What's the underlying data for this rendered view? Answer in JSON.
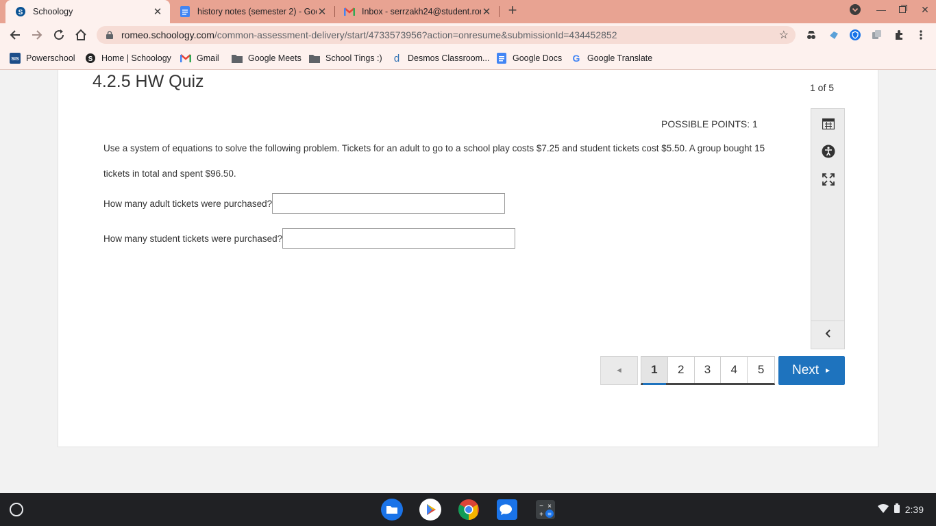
{
  "browser": {
    "tabs": [
      {
        "title": "Schoology",
        "icon": "schoology-icon",
        "active": true
      },
      {
        "title": "history notes (semester 2) - Goo",
        "icon": "google-docs-icon",
        "active": false
      },
      {
        "title": "Inbox - serrzakh24@student.rom",
        "icon": "gmail-icon",
        "active": false
      }
    ],
    "url_host": "romeo.schoology.com",
    "url_path": "/common-assessment-delivery/start/4733573956?action=onresume&submissionId=434452852",
    "bookmarks": [
      {
        "label": "Powerschool",
        "icon": "powerschool-icon"
      },
      {
        "label": "Home | Schoology",
        "icon": "schoology-icon"
      },
      {
        "label": "Gmail",
        "icon": "gmail-icon"
      },
      {
        "label": "Google Meets",
        "icon": "folder-icon"
      },
      {
        "label": "School Tings :)",
        "icon": "folder-icon"
      },
      {
        "label": "Desmos Classroom...",
        "icon": "desmos-icon"
      },
      {
        "label": "Google Docs",
        "icon": "google-docs-icon"
      },
      {
        "label": "Google Translate",
        "icon": "google-icon"
      }
    ]
  },
  "quiz": {
    "title": "4.2.5 HW Quiz",
    "page_count": "1 of 5",
    "points": "POSSIBLE POINTS: 1",
    "prompt": "Use a system of equations to solve the following problem.  Tickets for an adult to go to a school play costs $7.25 and student tickets cost $5.50.  A group bought 15 tickets in total and spent $96.50.",
    "questions": [
      {
        "label": "How many adult tickets were purchased?",
        "value": ""
      },
      {
        "label": "How many student tickets were purchased?",
        "value": ""
      }
    ],
    "pages": [
      "1",
      "2",
      "3",
      "4",
      "5"
    ],
    "current_page": "1",
    "prev_glyph": "◄",
    "next_label": "Next",
    "next_glyph": "►",
    "accent_color": "#1e73be"
  },
  "shelf": {
    "time": "2:39",
    "apps": [
      "files-icon",
      "play-store-icon",
      "chrome-icon",
      "messages-icon",
      "calculator-icon"
    ]
  }
}
